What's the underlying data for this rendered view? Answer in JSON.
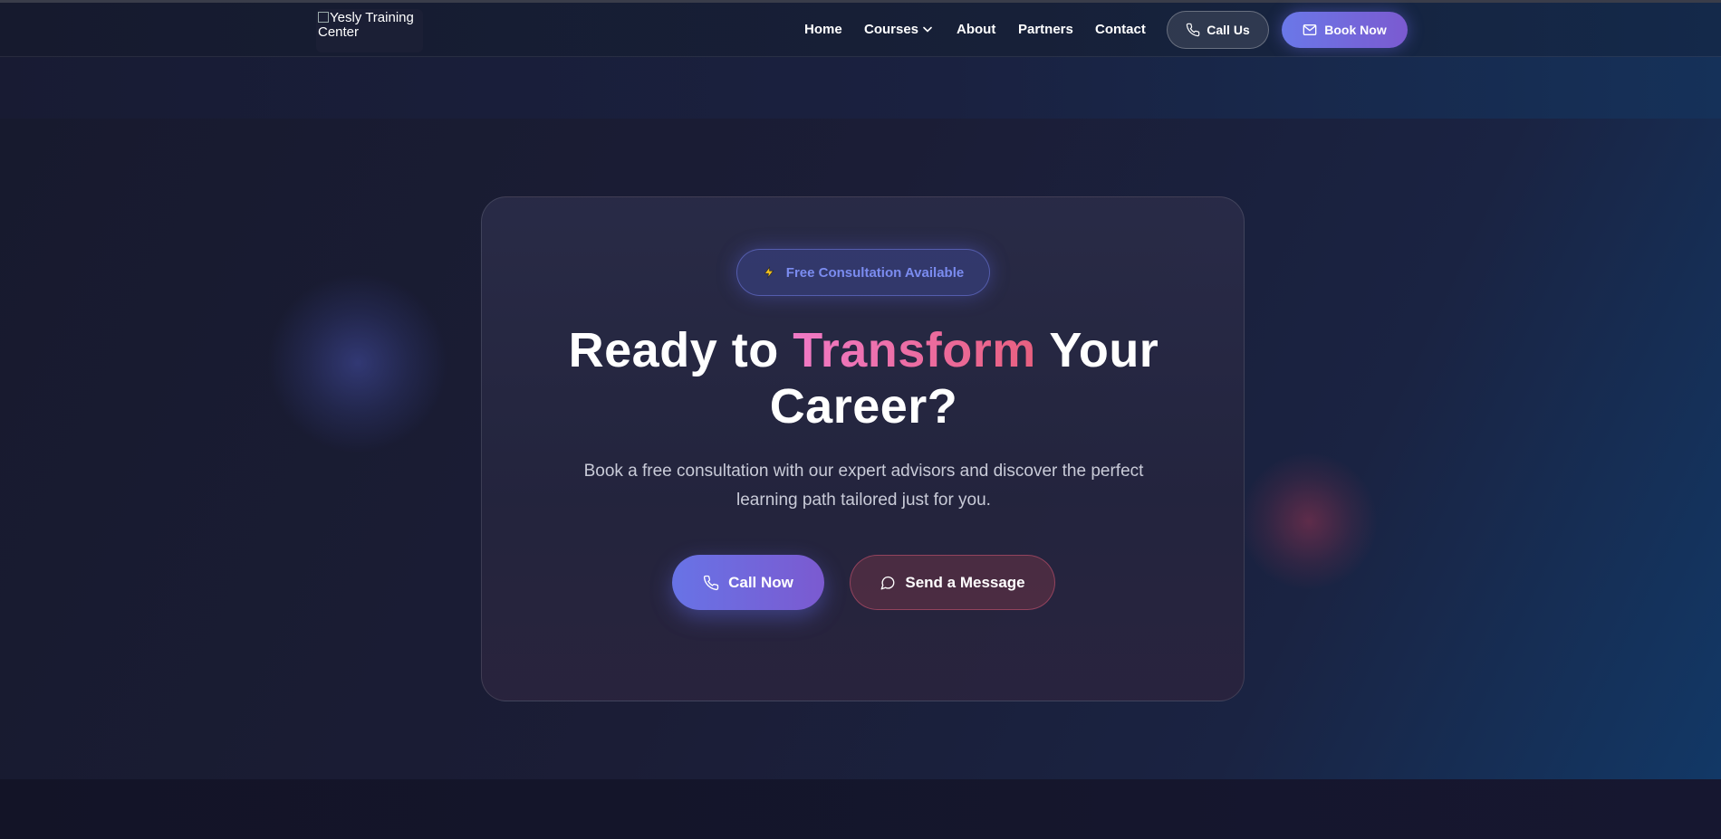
{
  "header": {
    "logo_alt": "Yesly Training Center",
    "nav": [
      {
        "label": "Home"
      },
      {
        "label": "Courses",
        "icon": "chevron-down-icon"
      },
      {
        "label": "About"
      },
      {
        "label": "Partners"
      },
      {
        "label": "Contact"
      }
    ],
    "call_us_label": "Call Us",
    "book_now_label": "Book Now"
  },
  "hero": {
    "badge": {
      "icon": "lightning-icon",
      "label": "Free Consultation Available"
    },
    "headline": {
      "before": "Ready to ",
      "accent": "Transform",
      "after": " Your",
      "line2": "Career?"
    },
    "subtext": "Book a free consultation with our expert advisors and discover the perfect learning path tailored just for you.",
    "call_now_label": "Call Now",
    "send_message_label": "Send a Message"
  },
  "colors": {
    "accent_purple": "#6a78e8",
    "accent_pink": "#f07ac6",
    "accent_red": "#e8607f",
    "background": "#1b1d36"
  }
}
